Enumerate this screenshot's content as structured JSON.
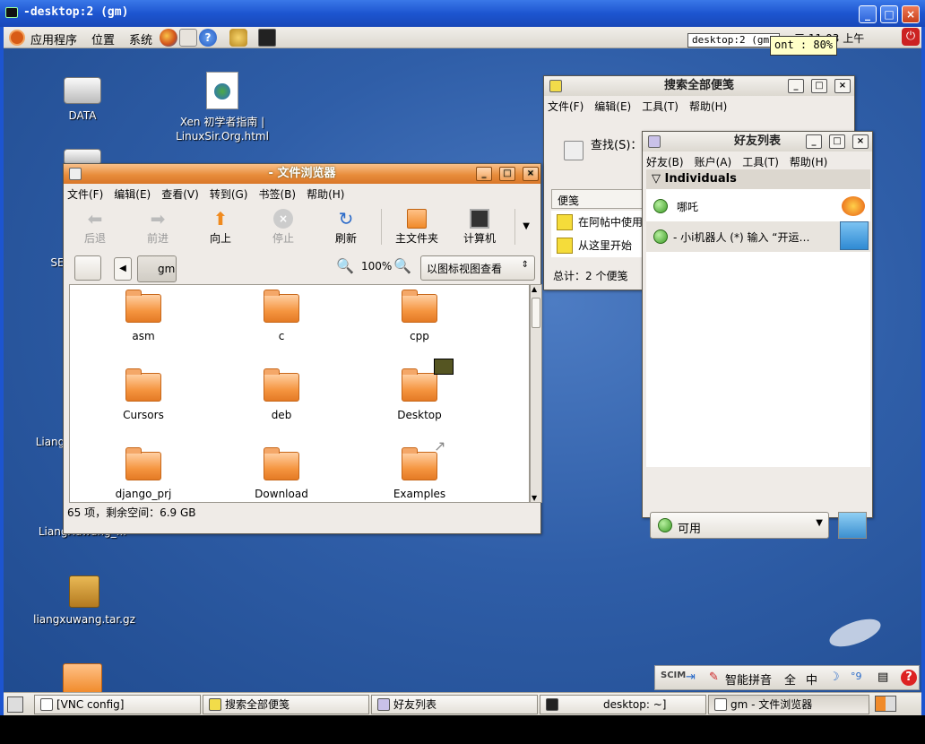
{
  "vnc": {
    "title": "-desktop:2 (gm)"
  },
  "top_panel": {
    "menus": [
      "应用程序",
      "位置",
      "系统"
    ],
    "task_label": "desktop:2 (gm)",
    "clock": "…三 11:03 上午",
    "tooltip": "ont : 80%"
  },
  "desktop": {
    "icons": [
      {
        "label": "DATA"
      },
      {
        "label": "Xen 初学者指南 | LinuxSir.Org.html"
      },
      {
        "label": "SE"
      },
      {
        "label": "Liang"
      },
      {
        "label": "LiangXuwang_..."
      },
      {
        "label": "liangxuwang.tar.gz"
      }
    ]
  },
  "file_browser": {
    "title": "- 文件浏览器",
    "menu": [
      "文件(F)",
      "编辑(E)",
      "查看(V)",
      "转到(G)",
      "书签(B)",
      "帮助(H)"
    ],
    "toolbar": {
      "back": "后退",
      "forward": "前进",
      "up": "向上",
      "stop": "停止",
      "reload": "刷新",
      "home": "主文件夹",
      "computer": "计算机"
    },
    "location": {
      "path_button": "gm",
      "zoom": "100%",
      "view_mode": "以图标视图查看"
    },
    "items": [
      "asm",
      "c",
      "cpp",
      "Cursors",
      "deb",
      "Desktop",
      "django_prj",
      "Download",
      "Examples"
    ],
    "status": "65 项，剩余空间：6.9 GB"
  },
  "notes_search": {
    "title": "搜索全部便笺",
    "menu": [
      "文件(F)",
      "编辑(E)",
      "工具(T)",
      "帮助(H)"
    ],
    "search_label": "查找(S)：",
    "column_header": "便笺",
    "notes": [
      "在阿帖中使用",
      "从这里开始"
    ],
    "total": "总计：2 个便笺"
  },
  "buddy_list": {
    "title": "好友列表",
    "menu": [
      "好友(B)",
      "账户(A)",
      "工具(T)",
      "帮助(H)"
    ],
    "group": "Individuals",
    "buddies": [
      {
        "name": "哪吒"
      },
      {
        "name": "- 小i机器人 (*) 输入 “开运…"
      }
    ],
    "status": "可用"
  },
  "ime": {
    "logo": "SCIM",
    "mode": "智能拼音",
    "full": "全",
    "lang": "中",
    "punct": "°9"
  },
  "bottom_panel": {
    "tasks": [
      {
        "label": "[VNC config]"
      },
      {
        "label": "搜索全部便笺"
      },
      {
        "label": "好友列表"
      },
      {
        "label": "desktop: ~]"
      },
      {
        "label": "gm - 文件浏览器"
      }
    ]
  },
  "colors": {
    "xp_title": "#1d55d0",
    "gnome_active_title": "#e88d3c",
    "desktop_bg": "#2f5ea8",
    "folder": "#f59540"
  }
}
